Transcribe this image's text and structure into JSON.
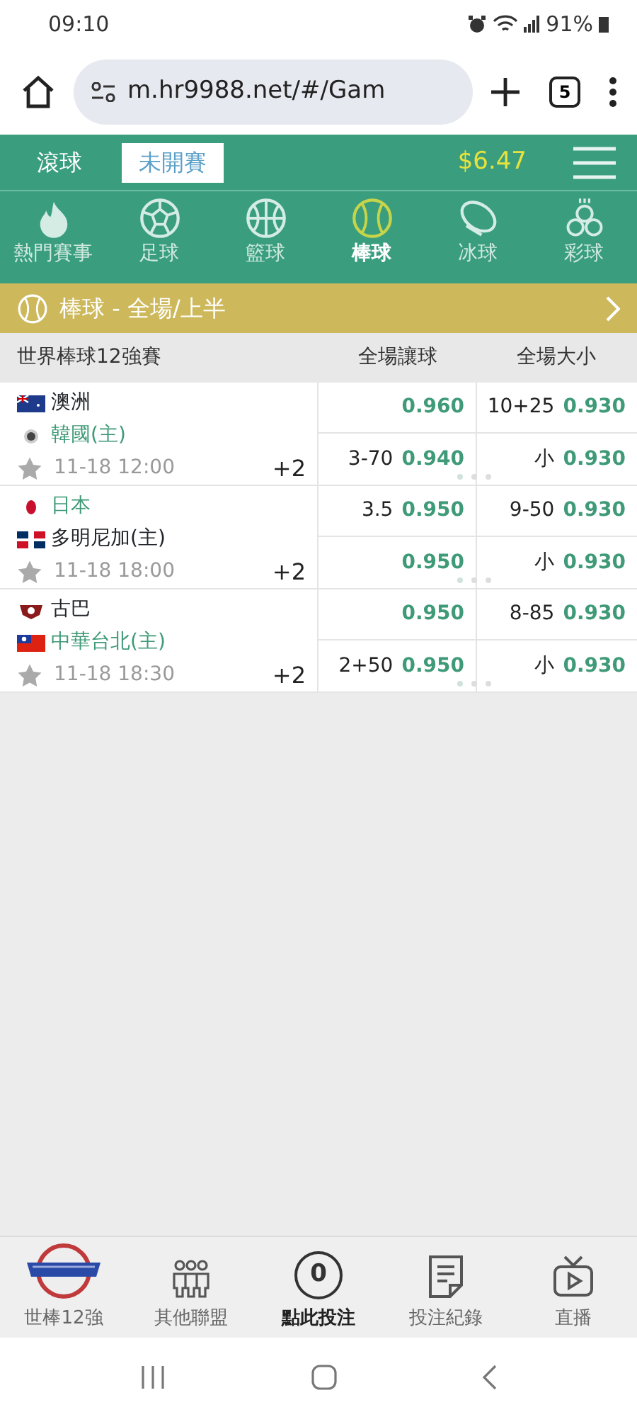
{
  "status_bar": {
    "time": "09:10",
    "battery": "91%"
  },
  "browser": {
    "url": "m.hr9988.net/#/Gam",
    "tab_count": "5"
  },
  "top_tabs": [
    {
      "label": "滾球",
      "selected": false
    },
    {
      "label": "未開賽",
      "selected": true
    }
  ],
  "balance": "$6.47",
  "sports": [
    {
      "label": "熱門賽事",
      "kind": "hot",
      "selected": false
    },
    {
      "label": "足球",
      "kind": "soccer",
      "selected": false
    },
    {
      "label": "籃球",
      "kind": "basketball",
      "selected": false
    },
    {
      "label": "棒球",
      "kind": "baseball",
      "selected": true
    },
    {
      "label": "冰球",
      "kind": "hockey",
      "selected": false
    },
    {
      "label": "彩球",
      "kind": "lottery",
      "selected": false
    }
  ],
  "section_bar": {
    "title": "棒球 - 全場/上半"
  },
  "table": {
    "league": "世界棒球12強賽",
    "columns": [
      "全場讓球",
      "全場大小"
    ],
    "matches": [
      {
        "teams": [
          {
            "name": "澳洲",
            "kind": "australia",
            "favored": false
          },
          {
            "name": "韓國(主)",
            "kind": "korea",
            "favored": true
          }
        ],
        "time": "11-18 12:00",
        "more": "+2",
        "lines": [
          {
            "handicap_odds": "0.960",
            "total": "10+25",
            "total_odds": "0.930"
          },
          {
            "handicap": "3-70",
            "handicap_odds": "0.940",
            "total": "小",
            "total_odds": "0.930"
          }
        ]
      },
      {
        "teams": [
          {
            "name": "日本",
            "kind": "japan",
            "favored": true
          },
          {
            "name": "多明尼加(主)",
            "kind": "dominican",
            "favored": false
          }
        ],
        "time": "11-18 18:00",
        "more": "+2",
        "lines": [
          {
            "handicap": "3.5",
            "handicap_odds": "0.950",
            "total": "9-50",
            "total_odds": "0.930"
          },
          {
            "handicap_odds": "0.950",
            "total": "小",
            "total_odds": "0.930"
          }
        ]
      },
      {
        "teams": [
          {
            "name": "古巴",
            "kind": "cuba",
            "favored": false
          },
          {
            "name": "中華台北(主)",
            "kind": "taipei",
            "favored": true
          }
        ],
        "time": "11-18 18:30",
        "more": "+2",
        "lines": [
          {
            "handicap_odds": "0.950",
            "total": "8-85",
            "total_odds": "0.930"
          },
          {
            "handicap": "2+50",
            "handicap_odds": "0.950",
            "total": "小",
            "total_odds": "0.930"
          }
        ]
      }
    ]
  },
  "bottom_nav": [
    {
      "label": "世棒12強",
      "kind": "logo",
      "selected": false
    },
    {
      "label": "其他聯盟",
      "kind": "people",
      "selected": false
    },
    {
      "label": "點此投注",
      "kind": "slip",
      "count": "0",
      "selected": true
    },
    {
      "label": "投注紀錄",
      "kind": "record",
      "selected": false
    },
    {
      "label": "直播",
      "kind": "tv",
      "selected": false
    }
  ]
}
